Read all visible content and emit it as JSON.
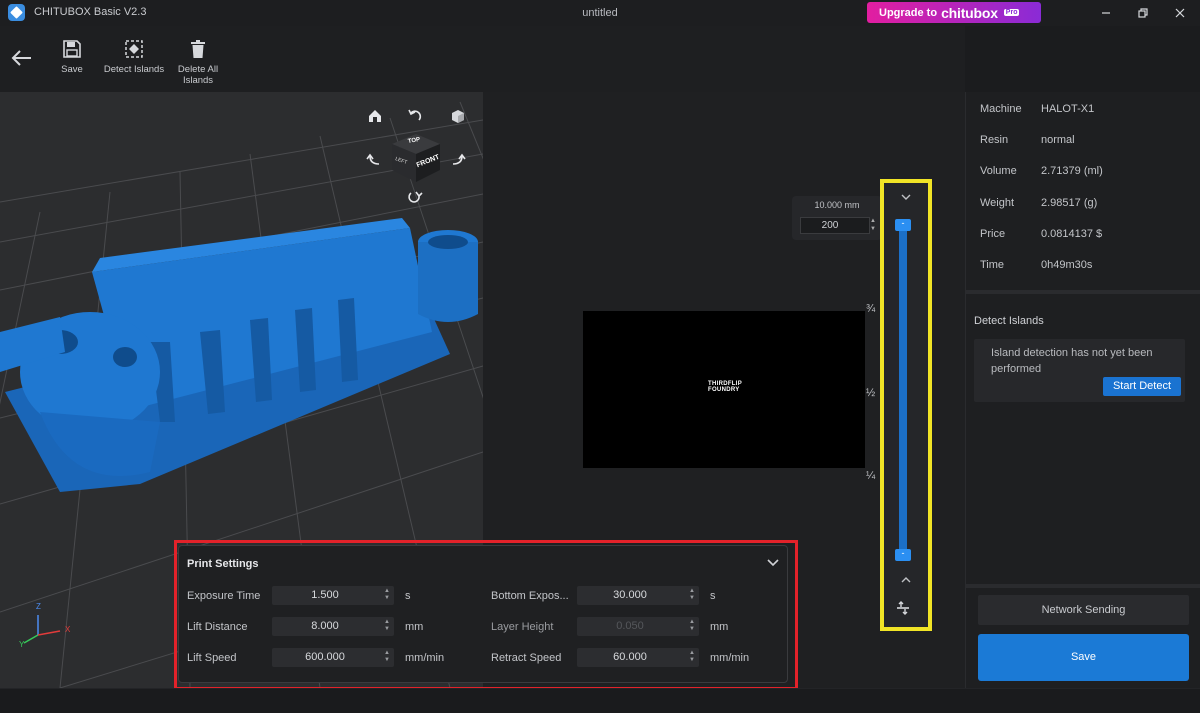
{
  "titlebar": {
    "app_title": "CHITUBOX Basic V2.3",
    "doc_title": "untitled",
    "upgrade_prefix": "Upgrade to",
    "upgrade_brand": "chitubox",
    "upgrade_badge": "Pro"
  },
  "toolbar": {
    "save_label": "Save",
    "detect_islands_label": "Detect Islands",
    "delete_all_islands_line1": "Delete All",
    "delete_all_islands_line2": "Islands"
  },
  "view_cube": {
    "top": "TOP",
    "left": "LEFT",
    "front": "FRONT"
  },
  "axes": {
    "x": "X",
    "y": "Y",
    "z": "Z"
  },
  "layer_control": {
    "height": "10.000 mm",
    "layer": "200"
  },
  "slider_marks": [
    "¾",
    "½",
    "¼"
  ],
  "slice_preview": {
    "text_line1": "THIRDFLIP",
    "text_line2": "FOUNDRY"
  },
  "print_settings": {
    "title": "Print Settings",
    "exposure_time": {
      "label": "Exposure Time",
      "value": "1.500",
      "unit": "s"
    },
    "lift_distance": {
      "label": "Lift Distance",
      "value": "8.000",
      "unit": "mm"
    },
    "lift_speed": {
      "label": "Lift Speed",
      "value": "600.000",
      "unit": "mm/min"
    },
    "bottom_exposure": {
      "label": "Bottom Expos...",
      "value": "30.000",
      "unit": "s"
    },
    "layer_height": {
      "label": "Layer Height",
      "value": "0.050",
      "unit": "mm"
    },
    "retract_speed": {
      "label": "Retract Speed",
      "value": "60.000",
      "unit": "mm/min"
    }
  },
  "info": {
    "machine": {
      "label": "Machine",
      "value": "HALOT-X1"
    },
    "resin": {
      "label": "Resin",
      "value": "normal"
    },
    "volume": {
      "label": "Volume",
      "value": "2.71379 (ml)"
    },
    "weight": {
      "label": "Weight",
      "value": "2.98517 (g)"
    },
    "price": {
      "label": "Price",
      "value": "0.0814137 $"
    },
    "time": {
      "label": "Time",
      "value": "0h49m30s"
    }
  },
  "detect_islands": {
    "title": "Detect Islands",
    "message": "Island detection has not yet been performed",
    "start_label": "Start Detect"
  },
  "actions": {
    "network_sending": "Network Sending",
    "save": "Save"
  },
  "colors": {
    "accent": "#1b7ad6",
    "model": "#1f78d1",
    "highlight_yellow": "#f1e426",
    "highlight_red": "#e3222a"
  }
}
